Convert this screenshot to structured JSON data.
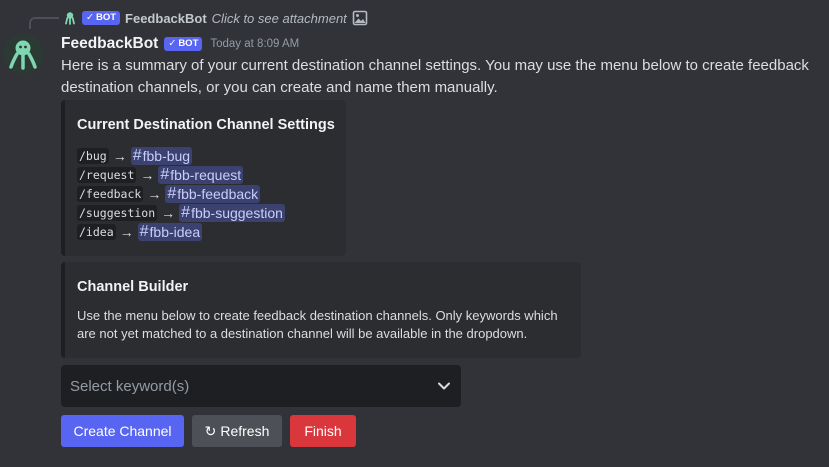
{
  "reply": {
    "bot_tag": "BOT",
    "username": "FeedbackBot",
    "text": "Click to see attachment"
  },
  "message": {
    "username": "FeedbackBot",
    "bot_tag": "BOT",
    "timestamp": "Today at 8:09 AM",
    "text": "Here is a summary of your current destination channel settings. You may use the menu below to create feedback destination channels, or you can create and name them manually."
  },
  "embed_settings": {
    "title": "Current Destination Channel Settings",
    "rows": [
      {
        "command": "/bug",
        "channel": "fbb-bug"
      },
      {
        "command": "/request",
        "channel": "fbb-request"
      },
      {
        "command": "/feedback",
        "channel": "fbb-feedback"
      },
      {
        "command": "/suggestion",
        "channel": "fbb-suggestion"
      },
      {
        "command": "/idea",
        "channel": "fbb-idea"
      }
    ],
    "arrow": "→",
    "hash": "#"
  },
  "embed_builder": {
    "title": "Channel Builder",
    "description": "Use the menu below to create feedback destination channels. Only keywords which are not yet matched to a destination channel will be available in the dropdown."
  },
  "select": {
    "placeholder": "Select keyword(s)"
  },
  "buttons": {
    "create": "Create Channel",
    "refresh_icon": "↻",
    "refresh": "Refresh",
    "finish": "Finish"
  },
  "colors": {
    "background": "#313338",
    "embed": "#2b2d31",
    "blurple": "#5865f2",
    "danger": "#da373c",
    "secondary": "#4e5058",
    "mention_bg": "#3c4270"
  },
  "icons": {
    "avatar": "feedbackbot-avatar",
    "attachment": "image-icon",
    "dropdown": "chevron-down-icon",
    "refresh": "refresh-icon"
  }
}
